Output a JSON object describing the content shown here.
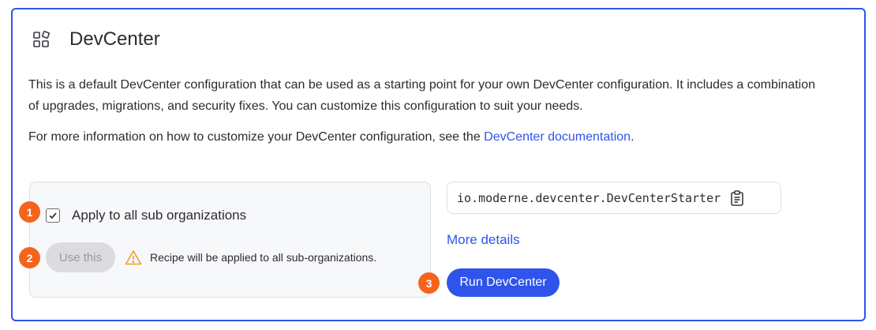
{
  "header": {
    "icon": "apps-grid-icon",
    "title": "DevCenter"
  },
  "description": "This is a default DevCenter configuration that can be used as a starting point for your own DevCenter configuration. It includes a combination of upgrades, migrations, and security fixes. You can customize this configuration to suit your needs.",
  "more_info": {
    "prefix": "For more information on how to customize your DevCenter configuration, see the ",
    "link_label": "DevCenter documentation",
    "suffix": "."
  },
  "options": {
    "apply_sub_orgs": {
      "label": "Apply to all sub organizations",
      "checked": true
    },
    "use_this_label": "Use this",
    "warning_icon": "warning-triangle-icon",
    "warning_text": "Recipe will be applied to all sub-organizations."
  },
  "recipe": {
    "id": "io.moderne.devcenter.DevCenterStarter",
    "copy_icon": "clipboard-icon"
  },
  "more_details_label": "More details",
  "run_button_label": "Run DevCenter",
  "steps": [
    "1",
    "2",
    "3"
  ],
  "colors": {
    "accent": "#2f54eb",
    "badge": "#f5641d",
    "warning": "#f0a020"
  }
}
